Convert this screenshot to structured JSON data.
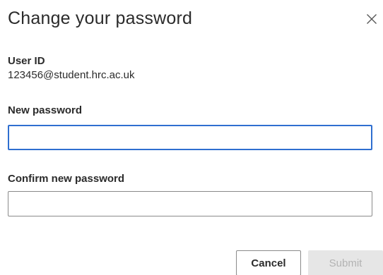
{
  "dialog": {
    "title": "Change your password",
    "close_icon": "close-icon"
  },
  "user": {
    "id_label": "User ID",
    "id_value": "123456@student.hrc.ac.uk"
  },
  "form": {
    "new_password_label": "New password",
    "new_password_value": "",
    "confirm_password_label": "Confirm new password",
    "confirm_password_value": ""
  },
  "actions": {
    "cancel_label": "Cancel",
    "submit_label": "Submit"
  },
  "colors": {
    "focus_border": "#2f6fd0",
    "disabled_bg": "#e6e6e6",
    "disabled_text": "#b3b3b3"
  }
}
